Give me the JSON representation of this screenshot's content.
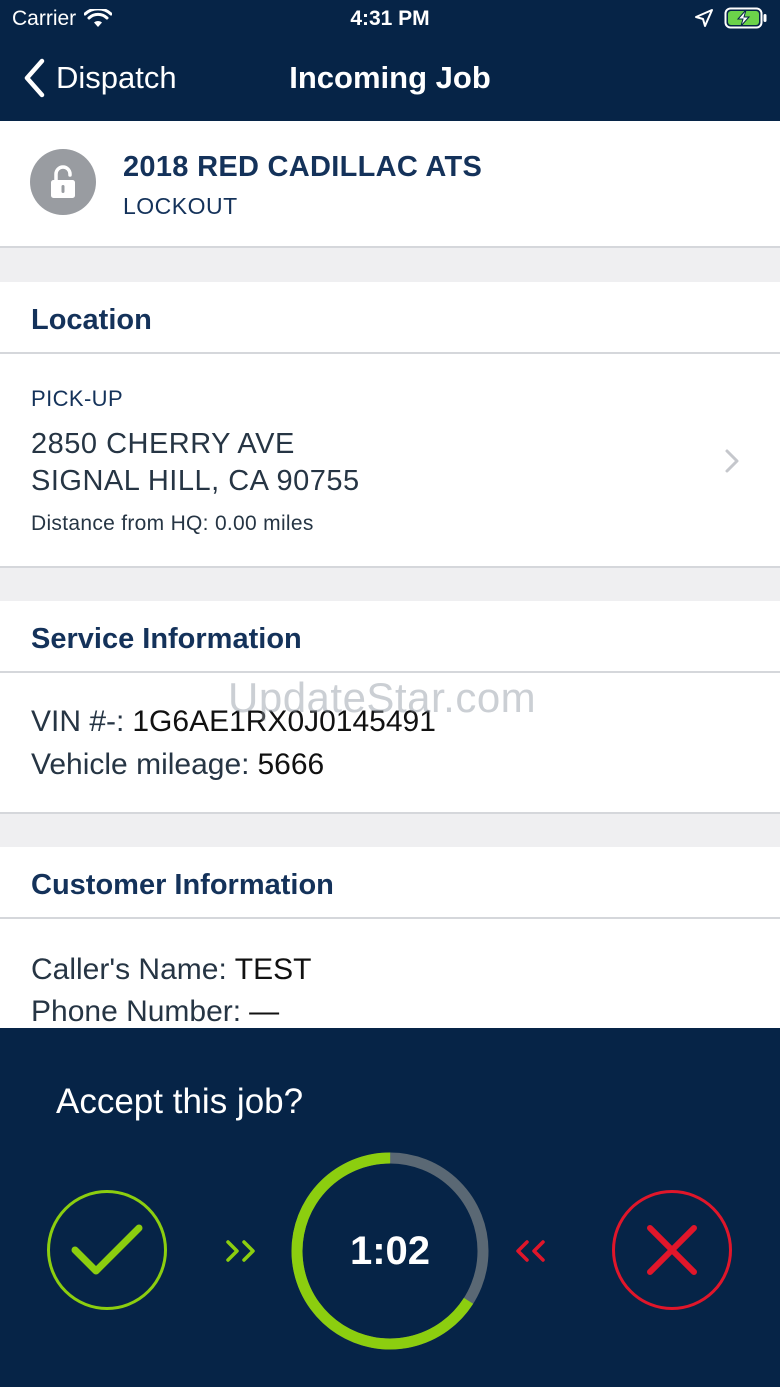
{
  "status_bar": {
    "carrier": "Carrier",
    "time": "4:31 PM"
  },
  "nav": {
    "back_label": "Dispatch",
    "title": "Incoming Job"
  },
  "job": {
    "vehicle": "2018 RED CADILLAC ATS",
    "service_type": "LOCKOUT"
  },
  "location": {
    "heading": "Location",
    "type_label": "PICK-UP",
    "address_line1": "2850 CHERRY AVE",
    "address_line2": "SIGNAL HILL, CA 90755",
    "distance": "Distance from HQ: 0.00 miles"
  },
  "service": {
    "heading": "Service Information",
    "vin_label": "VIN #-:",
    "vin_value": "1G6AE1RX0J0145491",
    "mileage_label": "Vehicle mileage:",
    "mileage_value": "5666"
  },
  "customer": {
    "heading": "Customer Information",
    "caller_label": "Caller's Name:",
    "caller_value": "TEST",
    "phone_label": "Phone Number:",
    "phone_value": "—"
  },
  "watermark": "UpdateStar.com",
  "accept": {
    "question": "Accept this job?",
    "timer": "1:02",
    "timer_progress": 0.66
  },
  "colors": {
    "navy": "#062447",
    "accent_green": "#8cce0f",
    "decline_red": "#e0162a",
    "section_title": "#14325a"
  },
  "icons": [
    "wifi-icon",
    "location-arrow-icon",
    "battery-charging-icon",
    "back-chevron-icon",
    "lock-icon",
    "chevron-right-icon",
    "checkmark-icon",
    "close-icon"
  ]
}
